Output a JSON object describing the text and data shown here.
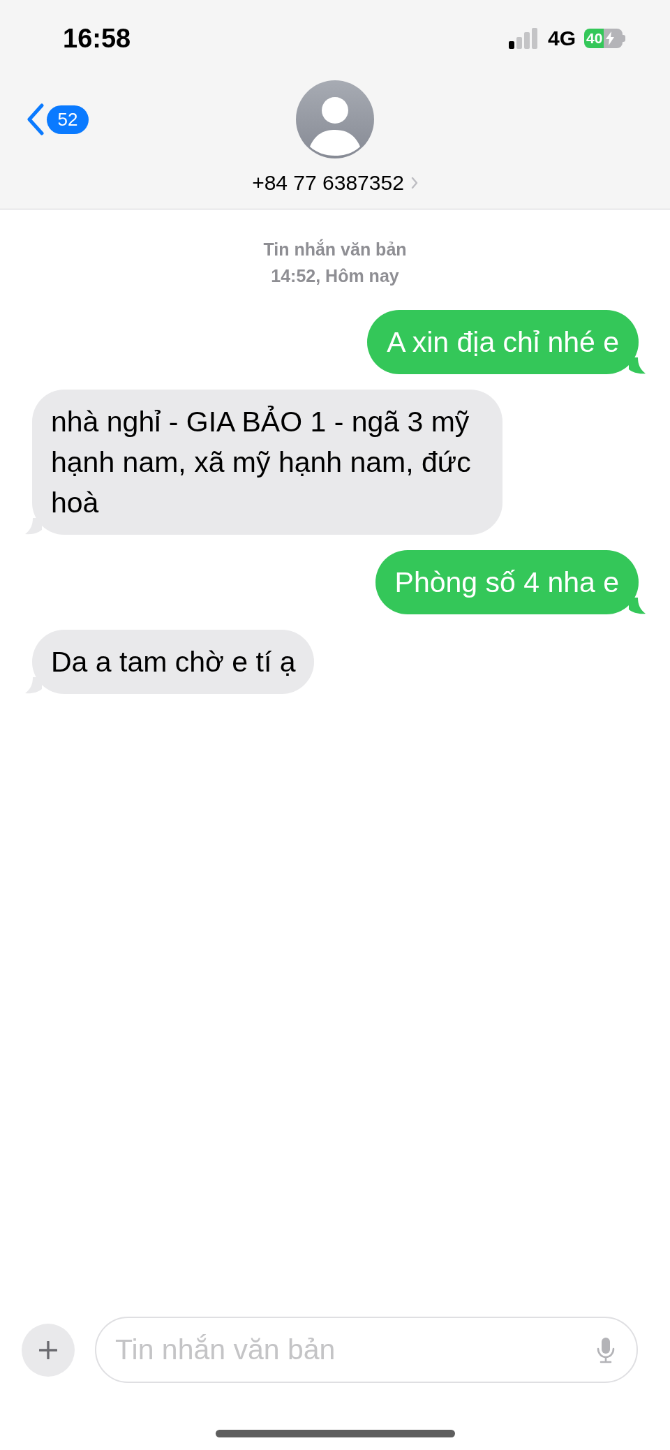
{
  "status_bar": {
    "time": "16:58",
    "network": "4G",
    "battery": "40",
    "charging": true
  },
  "header": {
    "unread_count": "52",
    "contact": "+84 77 6387352"
  },
  "thread": {
    "service": "Tin nhắn văn bản",
    "timestamp": "14:52, Hôm nay"
  },
  "messages": [
    {
      "kind": "sent",
      "text": "A xin địa chỉ nhé e"
    },
    {
      "kind": "received",
      "text": "nhà nghỉ - GIA BẢO 1 - ngã 3 mỹ hạnh nam, xã mỹ hạnh nam, đức hoà"
    },
    {
      "kind": "sent",
      "text": "Phòng số 4 nha e"
    },
    {
      "kind": "received",
      "text": "Da a tam chờ e tí ạ"
    }
  ],
  "composer": {
    "placeholder": "Tin nhắn văn bản"
  }
}
